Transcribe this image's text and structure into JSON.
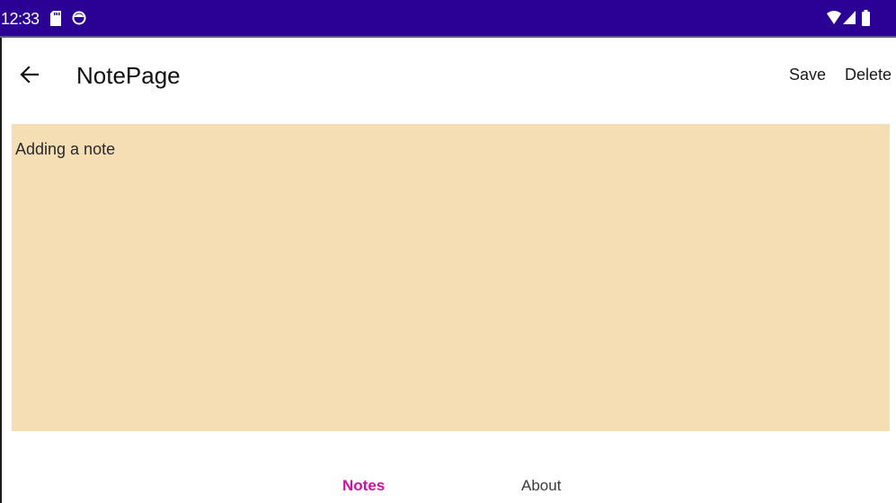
{
  "status_bar": {
    "time": "12:33",
    "background": "#2b0095",
    "icons": [
      "sd-card-icon",
      "face-icon",
      "wifi-icon",
      "signal-icon",
      "battery-icon"
    ]
  },
  "app_bar": {
    "title": "NotePage",
    "back_icon": "arrow-left-icon",
    "actions": {
      "save": "Save",
      "delete": "Delete"
    }
  },
  "editor": {
    "text": "Adding a note",
    "background": "#f5deb4"
  },
  "tabs": {
    "notes": "Notes",
    "about": "About",
    "selected": "notes",
    "selected_color": "#d00fa5"
  }
}
